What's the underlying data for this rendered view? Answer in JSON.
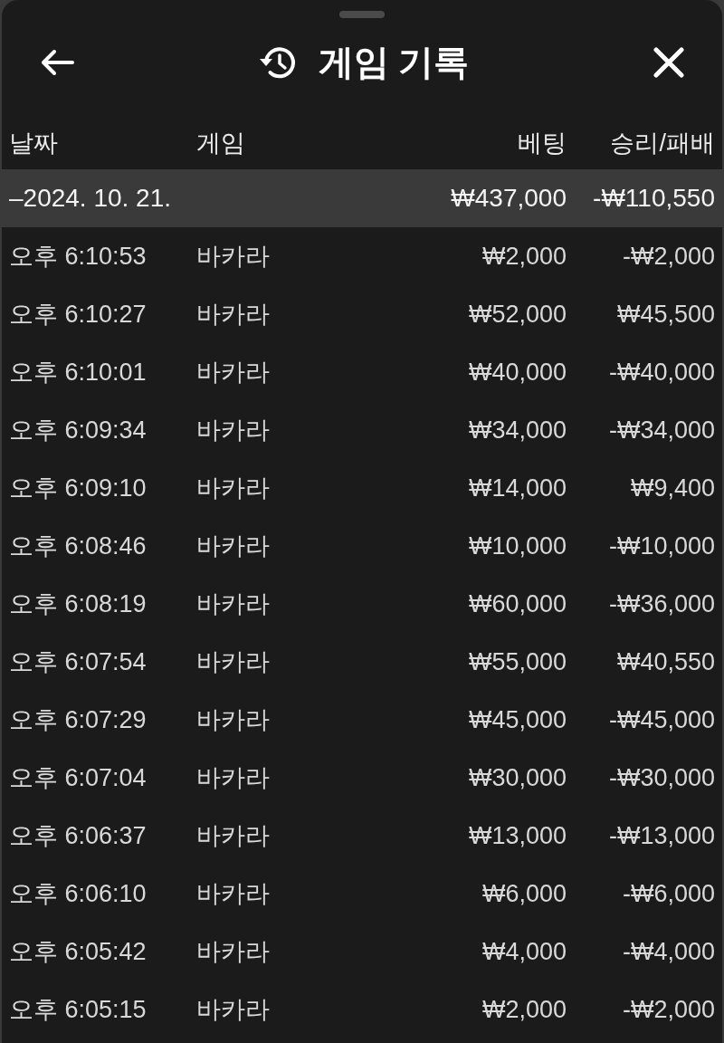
{
  "window": {
    "title": "게임 기록"
  },
  "table": {
    "columns": [
      "날짜",
      "게임",
      "베팅",
      "승리/패배"
    ],
    "groups": [
      {
        "label": "–2024. 10. 21.",
        "bet_total": "₩437,000",
        "result_total": "-₩110,550",
        "rows": [
          {
            "time": "오후 6:10:53",
            "game": "바카라",
            "bet": "₩2,000",
            "result": "-₩2,000"
          },
          {
            "time": "오후 6:10:27",
            "game": "바카라",
            "bet": "₩52,000",
            "result": "₩45,500"
          },
          {
            "time": "오후 6:10:01",
            "game": "바카라",
            "bet": "₩40,000",
            "result": "-₩40,000"
          },
          {
            "time": "오후 6:09:34",
            "game": "바카라",
            "bet": "₩34,000",
            "result": "-₩34,000"
          },
          {
            "time": "오후 6:09:10",
            "game": "바카라",
            "bet": "₩14,000",
            "result": "₩9,400"
          },
          {
            "time": "오후 6:08:46",
            "game": "바카라",
            "bet": "₩10,000",
            "result": "-₩10,000"
          },
          {
            "time": "오후 6:08:19",
            "game": "바카라",
            "bet": "₩60,000",
            "result": "-₩36,000"
          },
          {
            "time": "오후 6:07:54",
            "game": "바카라",
            "bet": "₩55,000",
            "result": "₩40,550"
          },
          {
            "time": "오후 6:07:29",
            "game": "바카라",
            "bet": "₩45,000",
            "result": "-₩45,000"
          },
          {
            "time": "오후 6:07:04",
            "game": "바카라",
            "bet": "₩30,000",
            "result": "-₩30,000"
          },
          {
            "time": "오후 6:06:37",
            "game": "바카라",
            "bet": "₩13,000",
            "result": "-₩13,000"
          },
          {
            "time": "오후 6:06:10",
            "game": "바카라",
            "bet": "₩6,000",
            "result": "-₩6,000"
          },
          {
            "time": "오후 6:05:42",
            "game": "바카라",
            "bet": "₩4,000",
            "result": "-₩4,000"
          },
          {
            "time": "오후 6:05:15",
            "game": "바카라",
            "bet": "₩2,000",
            "result": "-₩2,000"
          }
        ]
      }
    ]
  }
}
